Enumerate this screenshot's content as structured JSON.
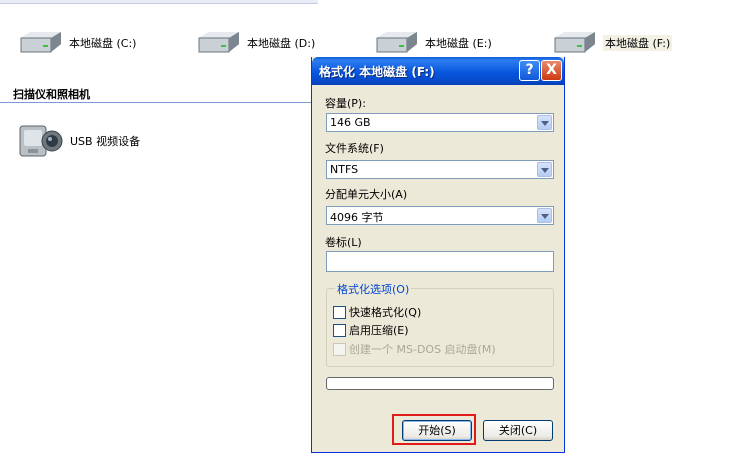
{
  "drives": [
    {
      "label": "本地磁盘 (C:)",
      "icon": "hard-drive-icon"
    },
    {
      "label": "本地磁盘 (D:)",
      "icon": "hard-drive-icon"
    },
    {
      "label": "本地磁盘 (E:)",
      "icon": "hard-drive-icon"
    },
    {
      "label": "本地磁盘 (F:)",
      "icon": "hard-drive-icon"
    }
  ],
  "section_title": "扫描仪和照相机",
  "usb_device": {
    "label": "USB 视频设备",
    "icon": "camera-icon"
  },
  "dialog": {
    "title": "格式化 本地磁盘 (F:)",
    "help_button": "?",
    "close_button": "X",
    "capacity_label": "容量(P):",
    "capacity_value": "146 GB",
    "filesystem_label": "文件系统(F)",
    "filesystem_value": "NTFS",
    "alloc_label": "分配单元大小(A)",
    "alloc_value": "4096 字节",
    "volume_label": "卷标(L)",
    "volume_value": "",
    "options_title": "格式化选项(O)",
    "options": [
      {
        "label": "快速格式化(Q)",
        "checked": false,
        "enabled": true
      },
      {
        "label": "启用压缩(E)",
        "checked": false,
        "enabled": true
      },
      {
        "label": "创建一个 MS-DOS 启动盘(M)",
        "checked": false,
        "enabled": false
      }
    ],
    "progress": 0,
    "start_button": "开始(S)",
    "close_button_label": "关闭(C)",
    "highlight_color": "#e01b1b"
  }
}
